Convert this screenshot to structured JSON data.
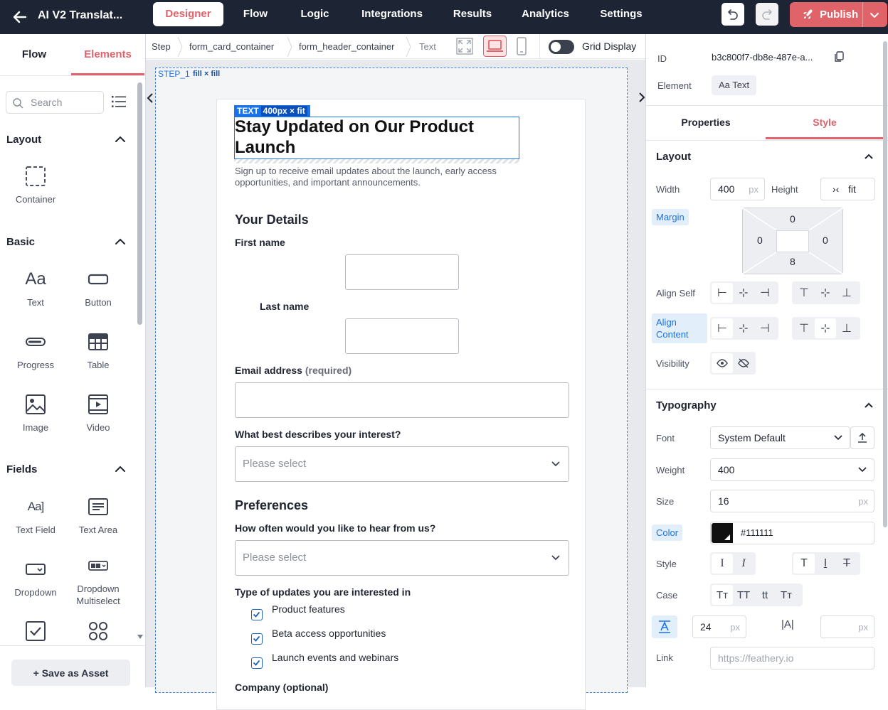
{
  "topbar": {
    "title": "AI V2 Translat...",
    "tabs": [
      "Designer",
      "Flow",
      "Logic",
      "Integrations",
      "Results",
      "Analytics",
      "Settings"
    ],
    "active_tab": "Designer",
    "publish_label": "Publish",
    "accent": "#e0636a",
    "bg": "#1d2433"
  },
  "left_panel": {
    "tabs": [
      "Flow",
      "Elements"
    ],
    "active_tab": "Elements",
    "search_placeholder": "Search",
    "sections": {
      "layout": {
        "title": "Layout",
        "items": [
          "Container"
        ]
      },
      "basic": {
        "title": "Basic",
        "items": [
          "Text",
          "Button",
          "Progress",
          "Table",
          "Image",
          "Video"
        ]
      },
      "fields": {
        "title": "Fields",
        "items": [
          "Text Field",
          "Text Area",
          "Dropdown",
          "Dropdown Multiselect"
        ]
      }
    },
    "save_asset_label": "+ Save as Asset"
  },
  "breadcrumb": {
    "items": [
      "Step",
      "form_card_container",
      "form_header_container",
      "Text"
    ],
    "grid_display_label": "Grid Display"
  },
  "canvas": {
    "step_label": "STEP_1",
    "step_fill": "fill × fill",
    "selection_tag": "TEXT",
    "selection_dim": "400px × fit",
    "form": {
      "title": "Stay Updated on Our Product Launch",
      "description": "Sign up to receive email updates about the launch, early access opportunities, and important announcements.",
      "section_details": "Your Details",
      "first_name_label": "First name",
      "last_name_label": "Last name",
      "email_label": "Email address",
      "email_required": "(required)",
      "interest_label": "What best describes your interest?",
      "interest_placeholder": "Please select",
      "section_preferences": "Preferences",
      "frequency_label": "How often would you like to hear from us?",
      "frequency_placeholder": "Please select",
      "updates_label": "Type of updates you are interested in",
      "update_options": [
        "Product features",
        "Beta access opportunities",
        "Launch events and webinars"
      ],
      "company_label": "Company (optional)"
    }
  },
  "right_panel": {
    "id_label": "ID",
    "id_value": "b3c800f7-db8e-487e-a...",
    "element_label": "Element",
    "element_value": "Text",
    "tabs": [
      "Properties",
      "Style"
    ],
    "active_tab": "Style",
    "layout": {
      "title": "Layout",
      "width_label": "Width",
      "width_value": "400",
      "width_unit": "px",
      "height_label": "Height",
      "height_value": "fit",
      "margin_label": "Margin",
      "margin_top": "0",
      "margin_left": "0",
      "margin_right": "0",
      "margin_bottom": "8",
      "align_self_label": "Align Self",
      "align_content_label": "Align Content",
      "visibility_label": "Visibility"
    },
    "typography": {
      "title": "Typography",
      "font_label": "Font",
      "font_value": "System Default",
      "weight_label": "Weight",
      "weight_value": "400",
      "size_label": "Size",
      "size_value": "16",
      "size_unit": "px",
      "color_label": "Color",
      "color_value": "#111111",
      "style_label": "Style",
      "case_label": "Case",
      "line_height_value": "24",
      "line_height_unit": "px",
      "letter_unit": "px",
      "link_label": "Link",
      "link_placeholder": "https://feathery.io"
    }
  }
}
